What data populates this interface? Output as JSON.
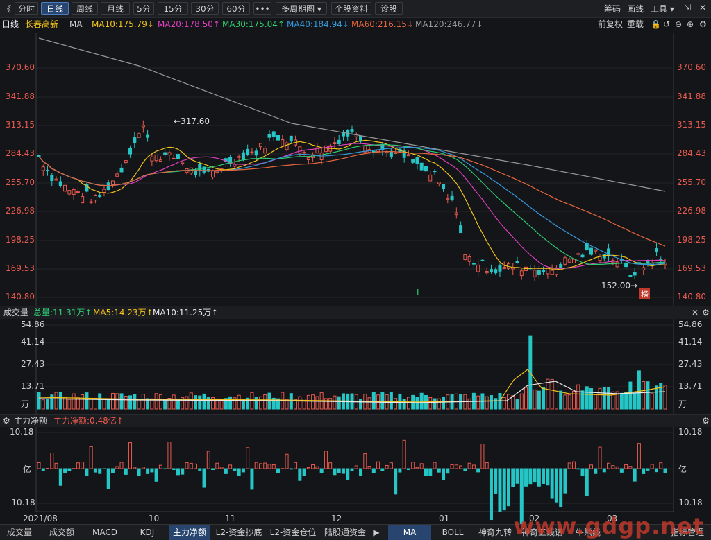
{
  "toolbar": {
    "back": "《",
    "buttons": [
      "分时",
      "日线",
      "周线",
      "月线",
      "5分",
      "15分",
      "30分",
      "60分",
      "•••",
      "多周期图 ▾",
      "个股资料",
      "诊股"
    ],
    "active_index": 1,
    "right": [
      "筹码",
      "画线",
      "工具 ▾",
      "⇲",
      "✕"
    ]
  },
  "info": {
    "period": "日线",
    "stock": "长春高新",
    "ma": "MA",
    "ma10": "MA10:175.79↓",
    "ma20": "MA20:178.50↑",
    "ma30": "MA30:175.04↑",
    "ma40": "MA40:184.94↓",
    "ma60": "MA60:216.15↓",
    "ma120": "MA120:246.77↓",
    "adjust": "前复权",
    "rights": "重载",
    "colors": {
      "ma10": "#f0c419",
      "ma20": "#e040c0",
      "ma30": "#2ecc71",
      "ma40": "#3498db",
      "ma60": "#e8663c",
      "ma120": "#999999"
    }
  },
  "price_axis": [
    "370.60",
    "341.88",
    "313.15",
    "284.43",
    "255.70",
    "226.98",
    "198.25",
    "169.53",
    "140.80"
  ],
  "annotations": {
    "high": "←317.60",
    "low": "152.00→",
    "l_mark": "L",
    "tag": "榜"
  },
  "volume": {
    "title": "成交量",
    "total": "总量:11.31万↑",
    "ma5": "MA5:14.23万↑",
    "ma10": "MA10:11.25万↑",
    "axis": [
      "54.86",
      "41.14",
      "27.43",
      "13.71",
      "万"
    ]
  },
  "capital": {
    "title": "主力净额",
    "value": "主力净额:0.48亿↑",
    "axis": [
      "10.18",
      "亿",
      "-10.18"
    ]
  },
  "dates": [
    "2021/08",
    "10",
    "11",
    "12",
    "01",
    "02",
    "03"
  ],
  "tabs": [
    "成交量",
    "成交额",
    "MACD",
    "KDJ",
    "主力净额",
    "L2-资金抄底",
    "L2-资金仓位",
    "陆股通资金",
    "▶",
    "MA",
    "BOLL",
    "神奇九转",
    "神奇五线谱",
    "牛熊线",
    "指标管理"
  ],
  "active_tab": 4,
  "watermark": "www.gdgp.net"
}
